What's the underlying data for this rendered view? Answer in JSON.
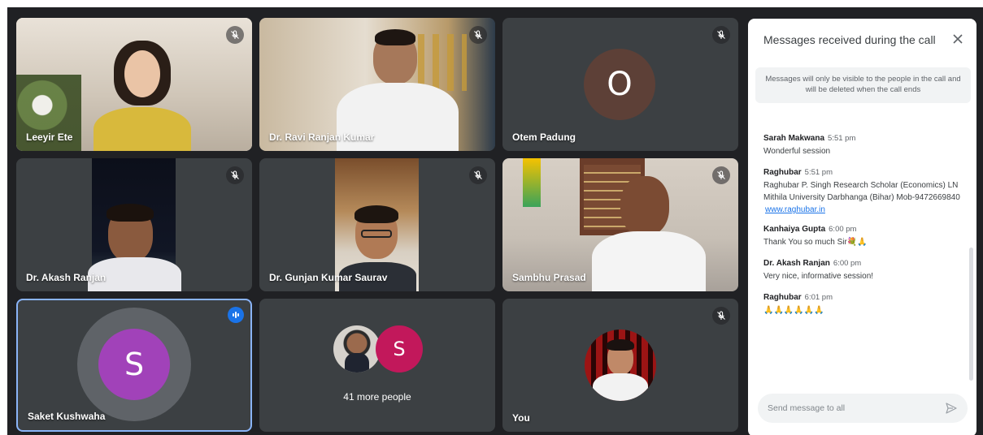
{
  "participants": [
    {
      "name": "Leeyir Ete",
      "muted": true
    },
    {
      "name": "Dr. Ravi Ranjan Kumar",
      "muted": true
    },
    {
      "name": "Otem Padung",
      "muted": true,
      "initial": "O",
      "avatar_color": "#5d4037"
    },
    {
      "name": "Dr. Akash Ranjan",
      "muted": true
    },
    {
      "name": "Dr. Gunjan Kumar Saurav",
      "muted": true
    },
    {
      "name": "Sambhu Prasad",
      "muted": true
    },
    {
      "name": "Saket Kushwaha",
      "speaking": true,
      "initial": "S",
      "avatar_color": "#a142b9"
    },
    {
      "more_text": "41 more people",
      "initial": "S",
      "avatar_color": "#c2185b"
    },
    {
      "name": "You",
      "muted": true
    }
  ],
  "chat": {
    "title": "Messages received during the call",
    "notice": "Messages will only be visible to the people in the call and will be deleted when the call ends",
    "messages": [
      {
        "sender": "Sarah Makwana",
        "time": "5:51 pm",
        "text": "Wonderful session"
      },
      {
        "sender": "Raghubar",
        "time": "5:51 pm",
        "text": "Raghubar P. Singh Research Scholar (Economics) LN Mithila University Darbhanga (Bihar) Mob-9472669840",
        "link": "www.raghubar.in"
      },
      {
        "sender": "Kanhaiya Gupta",
        "time": "6:00 pm",
        "text": "Thank You so much Sir💐🙏"
      },
      {
        "sender": "Dr. Akash Ranjan",
        "time": "6:00 pm",
        "text": "Very nice, informative session!"
      },
      {
        "sender": "Raghubar",
        "time": "6:01 pm",
        "text": "🙏🙏🙏🙏🙏🙏"
      }
    ],
    "input_placeholder": "Send message to all"
  },
  "colors": {
    "stage": "#202124",
    "tile": "#3c4043",
    "speaking_border": "#8ab4f8",
    "accent": "#1a73e8"
  }
}
